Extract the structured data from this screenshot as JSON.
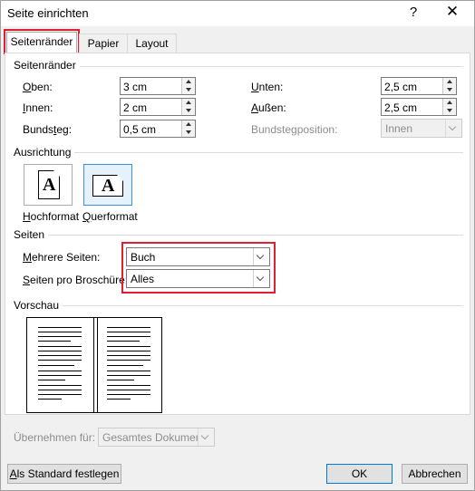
{
  "window": {
    "title": "Seite einrichten",
    "help_glyph": "?",
    "close_glyph": "✕"
  },
  "tabs": [
    {
      "label": "Seitenränder"
    },
    {
      "label": "Papier"
    },
    {
      "label": "Layout"
    }
  ],
  "margins": {
    "group_title": "Seitenränder",
    "oben": {
      "label_accel": "O",
      "label_rest": "ben:",
      "value": "3 cm"
    },
    "innen": {
      "label_accel": "I",
      "label_rest": "nnen:",
      "value": "2 cm"
    },
    "bundsteg": {
      "label_pre": "Bunds",
      "label_accel": "t",
      "label_rest": "eg:",
      "value": "0,5 cm"
    },
    "unten": {
      "label_accel": "U",
      "label_rest": "nten:",
      "value": "2,5 cm"
    },
    "aussen": {
      "label_accel": "A",
      "label_rest": "ußen:",
      "value": "2,5 cm"
    },
    "bundstegposition": {
      "label": "Bundstegposition:",
      "value": "Innen"
    }
  },
  "orientation": {
    "group_title": "Ausrichtung",
    "portrait": {
      "label_accel": "H",
      "label_rest": "ochformat",
      "icon_letter": "A"
    },
    "landscape": {
      "label_accel": "Q",
      "label_rest": "uerformat",
      "icon_letter": "A"
    }
  },
  "pages": {
    "group_title": "Seiten",
    "mehrere": {
      "label_accel": "M",
      "label_rest": "ehrere Seiten:",
      "value": "Buch"
    },
    "broschuere": {
      "label_accel": "S",
      "label_rest": "eiten pro Broschüre:",
      "value": "Alles"
    }
  },
  "preview": {
    "group_title": "Vorschau"
  },
  "apply": {
    "label": "Übernehmen für:",
    "value": "Gesamtes Dokument"
  },
  "buttons": {
    "default_accel": "A",
    "default_rest": "ls Standard festlegen",
    "ok": "OK",
    "cancel": "Abbrechen"
  },
  "colors": {
    "highlight": "#e02030",
    "selected_border": "#3c8fdc"
  }
}
